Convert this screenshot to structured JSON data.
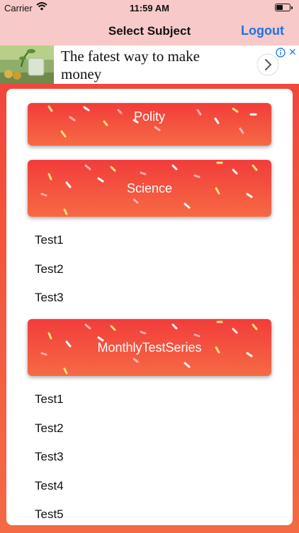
{
  "status_bar": {
    "carrier": "Carrier",
    "time": "11:59 AM",
    "icons": [
      "wifi-icon",
      "battery-icon"
    ]
  },
  "nav": {
    "title": "Select Subject",
    "logout_label": "Logout"
  },
  "ad": {
    "headline": "The fatest way to make money",
    "icons": [
      "info-icon",
      "close-icon",
      "chevron-right-icon"
    ]
  },
  "colors": {
    "nav_bg": "#f7c9c8",
    "accent_blue": "#1a73e8",
    "header_gradient_top": "#f23c3a",
    "header_gradient_bottom": "#f66a45"
  },
  "subjects": [
    {
      "name": "Polity",
      "tests": []
    },
    {
      "name": "Science",
      "tests": [
        "Test1",
        "Test2",
        "Test3"
      ]
    },
    {
      "name": "MonthlyTestSeries",
      "tests": [
        "Test1",
        "Test2",
        "Test3",
        "Test4",
        "Test5"
      ]
    }
  ]
}
